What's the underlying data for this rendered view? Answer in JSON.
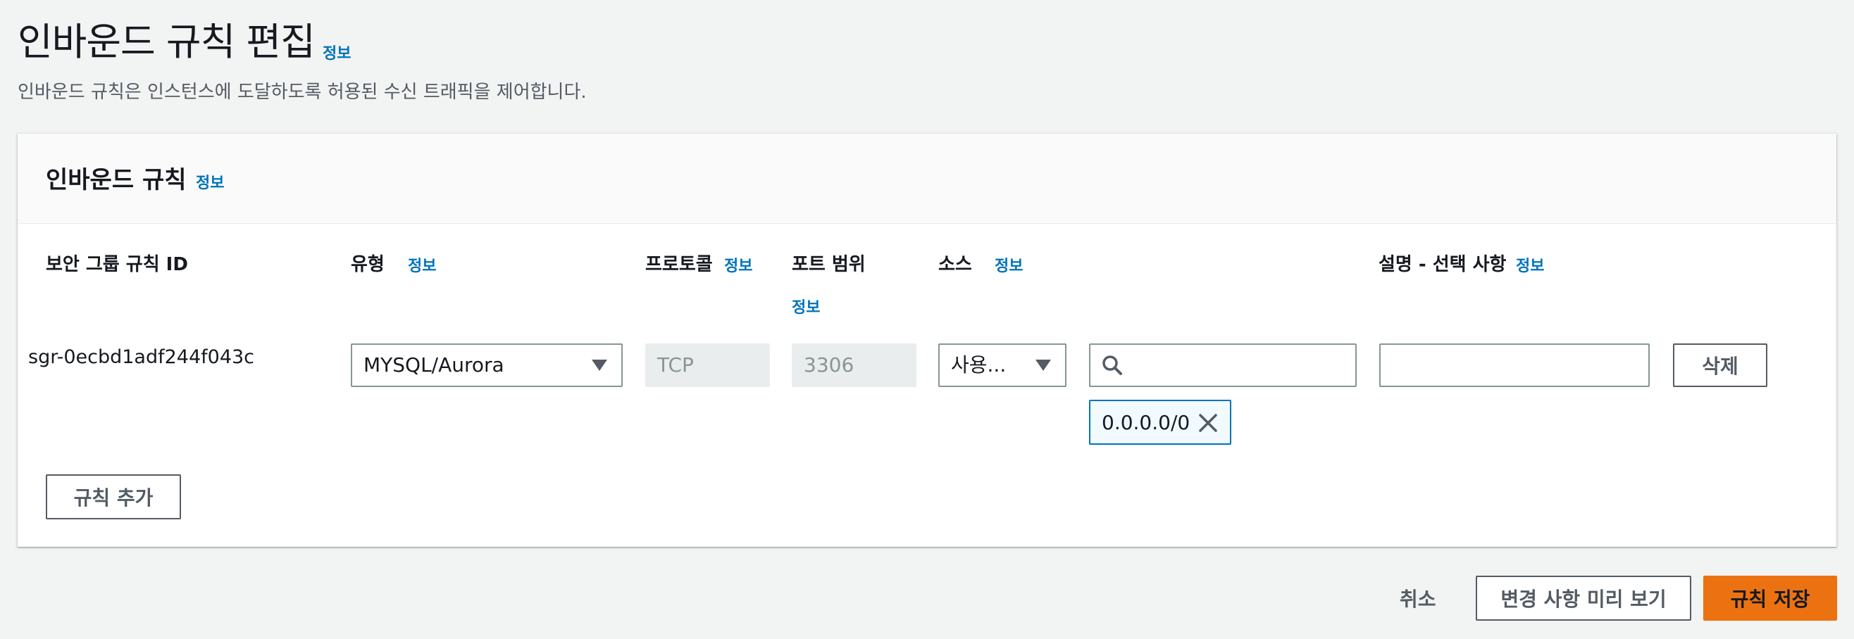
{
  "header": {
    "title": "인바운드 규칙 편집",
    "info": "정보",
    "description": "인바운드 규칙은 인스턴스에 도달하도록 허용된 수신 트래픽을 제어합니다."
  },
  "panel": {
    "title": "인바운드 규칙",
    "info": "정보",
    "columns": {
      "rule_id": "보안 그룹 규칙 ID",
      "type": "유형",
      "type_info": "정보",
      "protocol": "프로토콜",
      "protocol_info": "정보",
      "port_range": "포트 범위",
      "port_range_info": "정보",
      "source": "소스",
      "source_info": "정보",
      "description": "설명 - 선택 사항",
      "description_info": "정보"
    },
    "rule": {
      "id": "sgr-0ecbd1adf244f043c",
      "type": "MYSQL/Aurora",
      "protocol": "TCP",
      "port": "3306",
      "source_mode": "사용...",
      "source_search_value": "",
      "source_token": "0.0.0.0/0",
      "description_value": "",
      "delete_label": "삭제"
    },
    "add_rule_label": "규칙 추가"
  },
  "footer": {
    "cancel_label": "취소",
    "preview_label": "변경 사항 미리 보기",
    "save_label": "규칙 저장"
  },
  "icons": {
    "type_caret": "caret-down-icon",
    "source_caret": "caret-down-icon",
    "search": "search-icon",
    "token_remove": "close-icon"
  },
  "colors": {
    "background": "#f2f3f3",
    "link": "#0073bb",
    "primary_button": "#ec7211",
    "token_border": "#0073bb"
  }
}
